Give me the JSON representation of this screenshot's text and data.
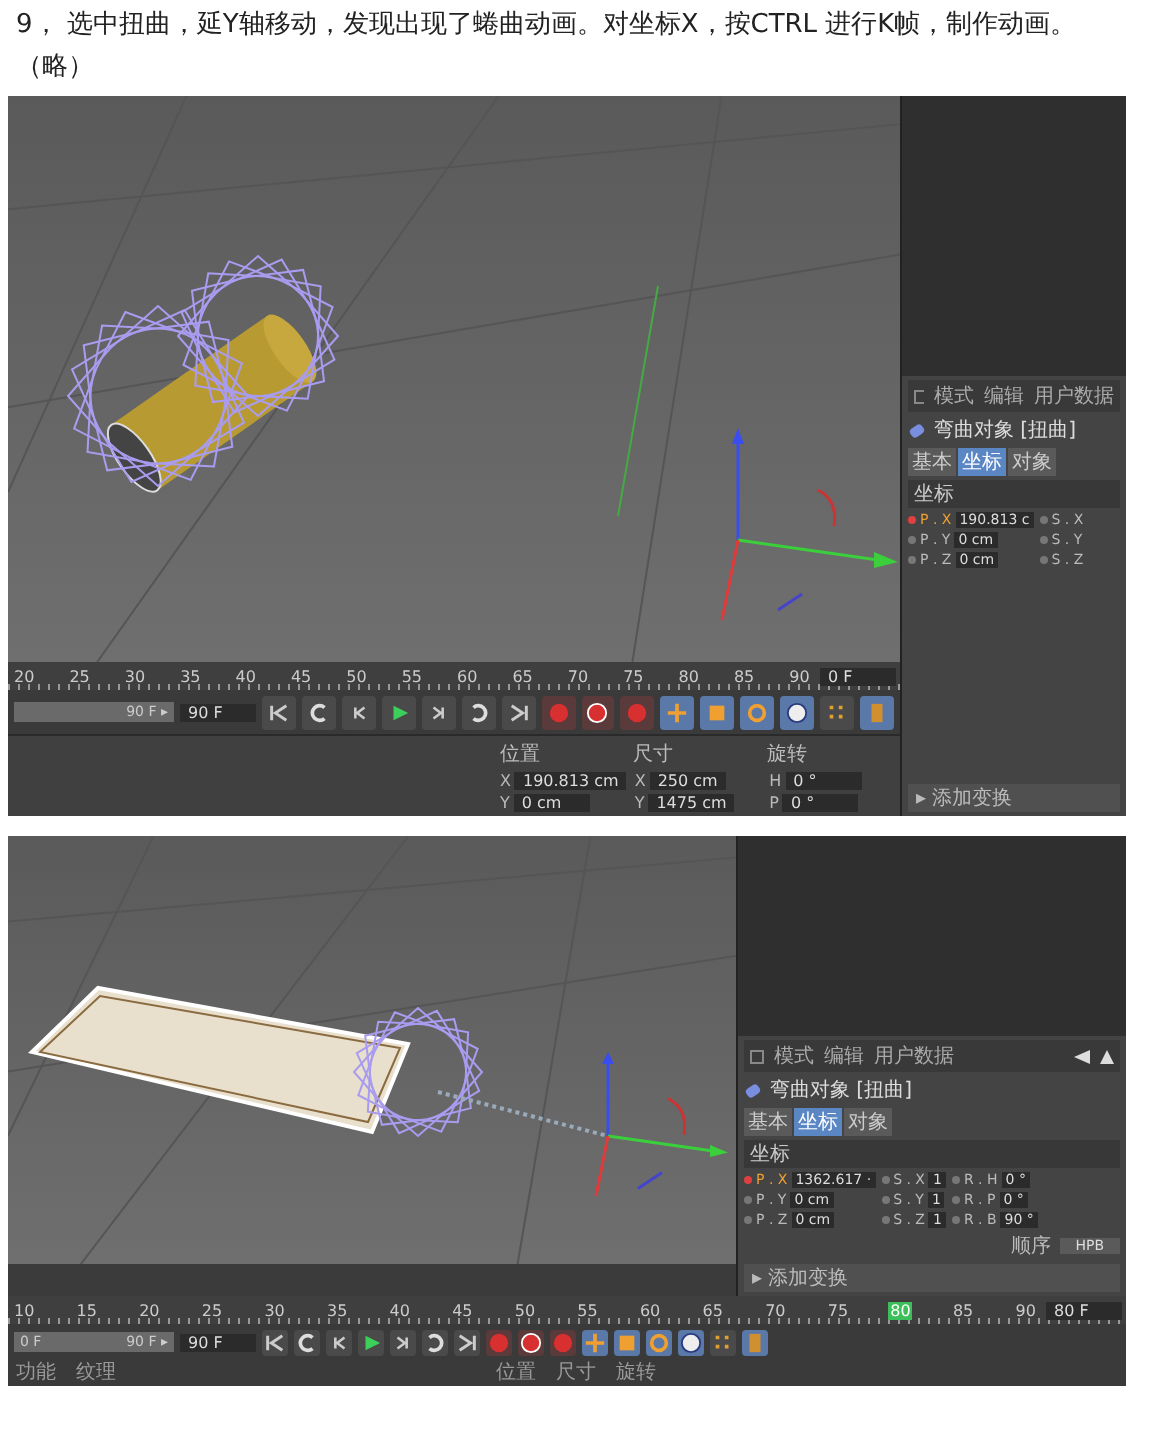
{
  "instruction": "9， 选中扭曲，延Y轴移动，发现出现了蜷曲动画。对坐标X，按CTRL 进行K帧，制作动画。（略）",
  "screenshots": [
    {
      "kind": "side",
      "attributes": {
        "menu": [
          "模式",
          "编辑",
          "用户数据"
        ],
        "object": "弯曲对象 [扭曲]",
        "subtabs": [
          {
            "label": "基本",
            "selected": false
          },
          {
            "label": "坐标",
            "selected": true
          },
          {
            "label": "对象",
            "selected": false
          }
        ],
        "section": "坐标",
        "rows": [
          [
            {
              "label": "P . X",
              "value": "190.813 c",
              "keyed": true
            },
            {
              "label": "S . X",
              "keyed": false
            }
          ],
          [
            {
              "label": "P . Y",
              "value": "0 cm",
              "keyed": false
            },
            {
              "label": "S . Y",
              "keyed": false
            }
          ],
          [
            {
              "label": "P . Z",
              "value": "0 cm",
              "keyed": false
            },
            {
              "label": "S . Z",
              "keyed": false
            }
          ]
        ],
        "footer": "▸ 添加变换"
      },
      "timeline": {
        "ticks": [
          {
            "label": "20",
            "current": false
          },
          {
            "label": "25",
            "current": false
          },
          {
            "label": "30",
            "current": false
          },
          {
            "label": "35",
            "current": false
          },
          {
            "label": "40",
            "current": false
          },
          {
            "label": "45",
            "current": false
          },
          {
            "label": "50",
            "current": false
          },
          {
            "label": "55",
            "current": false
          },
          {
            "label": "60",
            "current": false
          },
          {
            "label": "65",
            "current": false
          },
          {
            "label": "70",
            "current": false
          },
          {
            "label": "75",
            "current": false
          },
          {
            "label": "80",
            "current": false
          },
          {
            "label": "85",
            "current": false
          },
          {
            "label": "90",
            "current": false
          }
        ],
        "frame": "0 F",
        "range": {
          "end": "90 F ▸",
          "level": 1
        },
        "end_field": "90 F"
      },
      "coordinates": {
        "headers": [
          "位置",
          "尺寸",
          "旋转"
        ],
        "rows": [
          [
            {
              "axis": "X",
              "value": "190.813 cm"
            },
            {
              "axis": "X",
              "value": "250 cm"
            },
            {
              "axis": "H",
              "value": "0 °"
            }
          ],
          [
            {
              "axis": "Y",
              "value": "0 cm"
            },
            {
              "axis": "Y",
              "value": "1475 cm"
            },
            {
              "axis": "P",
              "value": "0 °"
            }
          ]
        ]
      }
    },
    {
      "kind": "bottom",
      "attributes": {
        "menu": [
          "模式",
          "编辑",
          "用户数据"
        ],
        "object": "弯曲对象 [扭曲]",
        "subtabs": [
          {
            "label": "基本",
            "selected": false
          },
          {
            "label": "坐标",
            "selected": true
          },
          {
            "label": "对象",
            "selected": false
          }
        ],
        "section": "坐标",
        "rows": [
          [
            {
              "label": "P . X",
              "value": "1362.617 ·",
              "keyed": true
            },
            {
              "label": "S . X",
              "value": "1",
              "keyed": false
            },
            {
              "label": "R . H",
              "value": "0 °",
              "keyed": false
            }
          ],
          [
            {
              "label": "P . Y",
              "value": "0 cm",
              "keyed": false
            },
            {
              "label": "S . Y",
              "value": "1",
              "keyed": false
            },
            {
              "label": "R . P",
              "value": "0 °",
              "keyed": false
            }
          ],
          [
            {
              "label": "P . Z",
              "value": "0 cm",
              "keyed": false
            },
            {
              "label": "S . Z",
              "value": "1",
              "keyed": false
            },
            {
              "label": "R . B",
              "value": "90 °",
              "keyed": false
            }
          ]
        ],
        "order": {
          "label": "顺序",
          "value": "HPB"
        },
        "footer": "▸ 添加变换"
      },
      "timeline": {
        "ticks": [
          {
            "label": "10",
            "current": false
          },
          {
            "label": "15",
            "current": false
          },
          {
            "label": "20",
            "current": false
          },
          {
            "label": "25",
            "current": false
          },
          {
            "label": "30",
            "current": false
          },
          {
            "label": "35",
            "current": false
          },
          {
            "label": "40",
            "current": false
          },
          {
            "label": "45",
            "current": false
          },
          {
            "label": "50",
            "current": false
          },
          {
            "label": "55",
            "current": false
          },
          {
            "label": "60",
            "current": false
          },
          {
            "label": "65",
            "current": false
          },
          {
            "label": "70",
            "current": false
          },
          {
            "label": "75",
            "current": false
          },
          {
            "label": "80",
            "current": true
          },
          {
            "label": "85",
            "current": false
          },
          {
            "label": "90",
            "current": false
          }
        ],
        "frame": "80 F",
        "range": {
          "start": "0 F",
          "end": "90 F ▸",
          "level": 1
        },
        "end_field": "90 F"
      },
      "bottom_labels": [
        "功能",
        "纹理",
        "位置",
        "尺寸",
        "旋转"
      ]
    }
  ]
}
